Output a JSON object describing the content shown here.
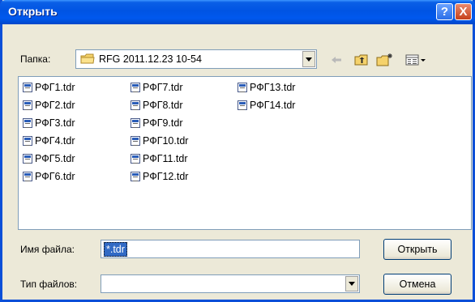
{
  "window": {
    "title": "Открыть",
    "help_symbol": "?",
    "close_symbol": "X"
  },
  "lookin": {
    "label": "Папка:",
    "value": "RFG 2011.12.23 10-54"
  },
  "files": [
    "РФГ1.tdr",
    "РФГ2.tdr",
    "РФГ3.tdr",
    "РФГ4.tdr",
    "РФГ5.tdr",
    "РФГ6.tdr",
    "РФГ7.tdr",
    "РФГ8.tdr",
    "РФГ9.tdr",
    "РФГ10.tdr",
    "РФГ11.tdr",
    "РФГ12.tdr",
    "РФГ13.tdr",
    "РФГ14.tdr"
  ],
  "filename": {
    "label": "Имя файла:",
    "value": "*.tdr"
  },
  "filetype": {
    "label": "Тип файлов:",
    "value": ""
  },
  "buttons": {
    "open": "Открыть",
    "cancel": "Отмена"
  }
}
